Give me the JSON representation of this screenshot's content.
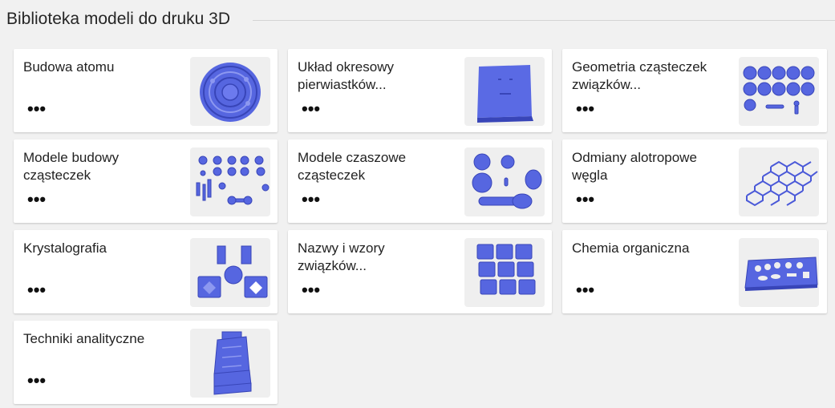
{
  "page": {
    "title": "Biblioteka modeli do druku 3D"
  },
  "colors": {
    "model": "#5666e0",
    "model_dark": "#3845b8",
    "model_light": "#8d98f0",
    "thumb_bg": "#efefef"
  },
  "cards": [
    {
      "title": "Budowa atomu",
      "more": "•••",
      "icon": "atom-model-icon"
    },
    {
      "title": "Układ okresowy pierwiastków...",
      "more": "•••",
      "icon": "periodic-table-model-icon"
    },
    {
      "title": "Geometria cząsteczek związków...",
      "more": "•••",
      "icon": "molecular-geometry-model-icon"
    },
    {
      "title": "Modele budowy cząsteczek",
      "more": "•••",
      "icon": "molecule-kit-model-icon"
    },
    {
      "title": "Modele czaszowe cząsteczek",
      "more": "•••",
      "icon": "space-filling-model-icon"
    },
    {
      "title": "Odmiany alotropowe węgla",
      "more": "•••",
      "icon": "graphene-model-icon"
    },
    {
      "title": "Krystalografia",
      "more": "•••",
      "icon": "crystal-model-icon"
    },
    {
      "title": "Nazwy i wzory związków...",
      "more": "•••",
      "icon": "formula-tiles-model-icon"
    },
    {
      "title": "Chemia organiczna",
      "more": "•••",
      "icon": "organic-stencil-model-icon"
    },
    {
      "title": "Techniki analityczne",
      "more": "•••",
      "icon": "analytical-device-model-icon"
    }
  ]
}
